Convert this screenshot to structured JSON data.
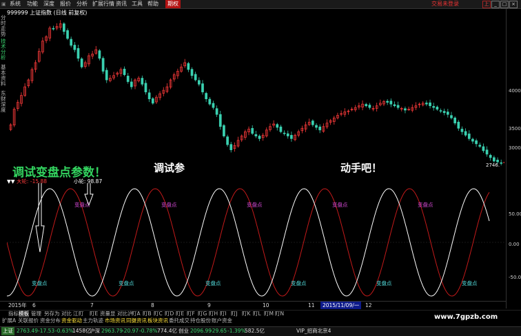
{
  "menu": {
    "items": [
      "系统",
      "功能",
      "深度",
      "报价",
      "分析",
      "扩展行情",
      "资讯",
      "工具",
      "帮助"
    ],
    "active": "期权",
    "right_link": "交易未登录",
    "window_buttons": [
      "上",
      "_",
      "□",
      "×"
    ]
  },
  "left_tabs": [
    "分时走势",
    "技术分析",
    "基本资料",
    "东财深度"
  ],
  "chart": {
    "code": "999999",
    "name": "上证指数",
    "period": "(日线 前复权)",
    "y_ticks": [
      "4000",
      "3500",
      "3000",
      "50.00",
      "0.00",
      "-50.00"
    ],
    "last_price": "2746."
  },
  "overlay": {
    "text1": "调试变盘点参数！",
    "text2": "调试参",
    "text3": "动手吧！"
  },
  "indicator": {
    "name": "▼▼",
    "big_label": "大轮:",
    "big_value": "-15.88",
    "small_label": "小轮:",
    "small_value": "98.87",
    "marker_label": "变盘点"
  },
  "dates": {
    "labels": [
      "2015年",
      "6",
      "7",
      "8",
      "9",
      "10",
      "11",
      "12"
    ],
    "selected": "2015/11/09/一"
  },
  "tabs1": [
    "指标",
    "模板",
    "管理",
    "另存为",
    "对比",
    "江",
    "盯",
    "盯E",
    "资量显",
    "对比沪",
    "盯A",
    "盯B",
    "盯C",
    "盯D",
    "盯E",
    "盯F",
    "盯G",
    "盯H",
    "盯I",
    "盯J",
    "盯K",
    "盯L",
    "盯M",
    "盯N"
  ],
  "tabs2": [
    "扩展A",
    "关联报价",
    "资金分布",
    "资金驱动",
    "主力轨迹",
    "市场资讯",
    "同摄资讯",
    "板块资讯",
    "委托成交",
    "持仓股份",
    "账户资金"
  ],
  "watermark": "www.7gpzb.com",
  "status": {
    "sh_label": "上证",
    "sh": "2763.49",
    "sh_chg": "-17.53",
    "sh_pct": "-0.63%",
    "sh_amt": "1458亿",
    "hs_label": "沪深",
    "hs": "2963.79",
    "hs_chg": "-20.97",
    "hs_pct": "-0.78%",
    "hs_amt": "774.4亿",
    "cy_label": "创业",
    "cy": "2096.99",
    "cy_chg": "-29.65",
    "cy_pct": "-1.39%",
    "cy_amt": "582.5亿",
    "vip": "VIP_招商北京4"
  },
  "colors": {
    "up": "#ff3b3b",
    "down": "#3ad0b0",
    "ind_white": "#ffffff",
    "ind_red": "#c41a1a",
    "marker": "#d64ad6"
  },
  "chart_data": {
    "type": "candlestick",
    "closes": [
      3180,
      3360,
      3440,
      3520,
      3620,
      3700,
      3820,
      3900,
      4030,
      4150,
      4200,
      4300,
      4290,
      4320,
      4350,
      4260,
      4180,
      4100,
      4050,
      3950,
      3850,
      3900,
      3980,
      4000,
      4050,
      3950,
      3800,
      3700,
      3720,
      3750,
      3780,
      3820,
      3760,
      3680,
      3620,
      3700,
      3720,
      3650,
      3560,
      3480,
      3430,
      3500,
      3540,
      3580,
      3620,
      3700,
      3760,
      3800,
      3850,
      3900,
      3820,
      3750,
      3700,
      3650,
      3560,
      3480,
      3420,
      3380,
      3300,
      3160,
      3050,
      2950,
      2890,
      2940,
      3000,
      3050,
      3100,
      3130,
      3080,
      3050,
      3020,
      3060,
      3120,
      3160,
      3190,
      3150,
      3100,
      3080,
      3050,
      3020,
      3060,
      3100,
      3140,
      3180,
      3210,
      3180,
      3150,
      3120,
      3160,
      3200,
      3230,
      3260,
      3290,
      3310,
      3330,
      3340,
      3360,
      3380,
      3400,
      3420,
      3400,
      3380,
      3370,
      3400,
      3430,
      3450,
      3440,
      3420,
      3400,
      3380,
      3370,
      3350,
      3360,
      3380,
      3400,
      3420,
      3430,
      3420,
      3400,
      3380,
      3360,
      3340,
      3320,
      3300,
      3260,
      3200,
      3140,
      3100,
      3060,
      3020,
      2990,
      2960,
      2930,
      2880,
      2840,
      2800,
      2760,
      2750,
      2740,
      2746
    ]
  }
}
